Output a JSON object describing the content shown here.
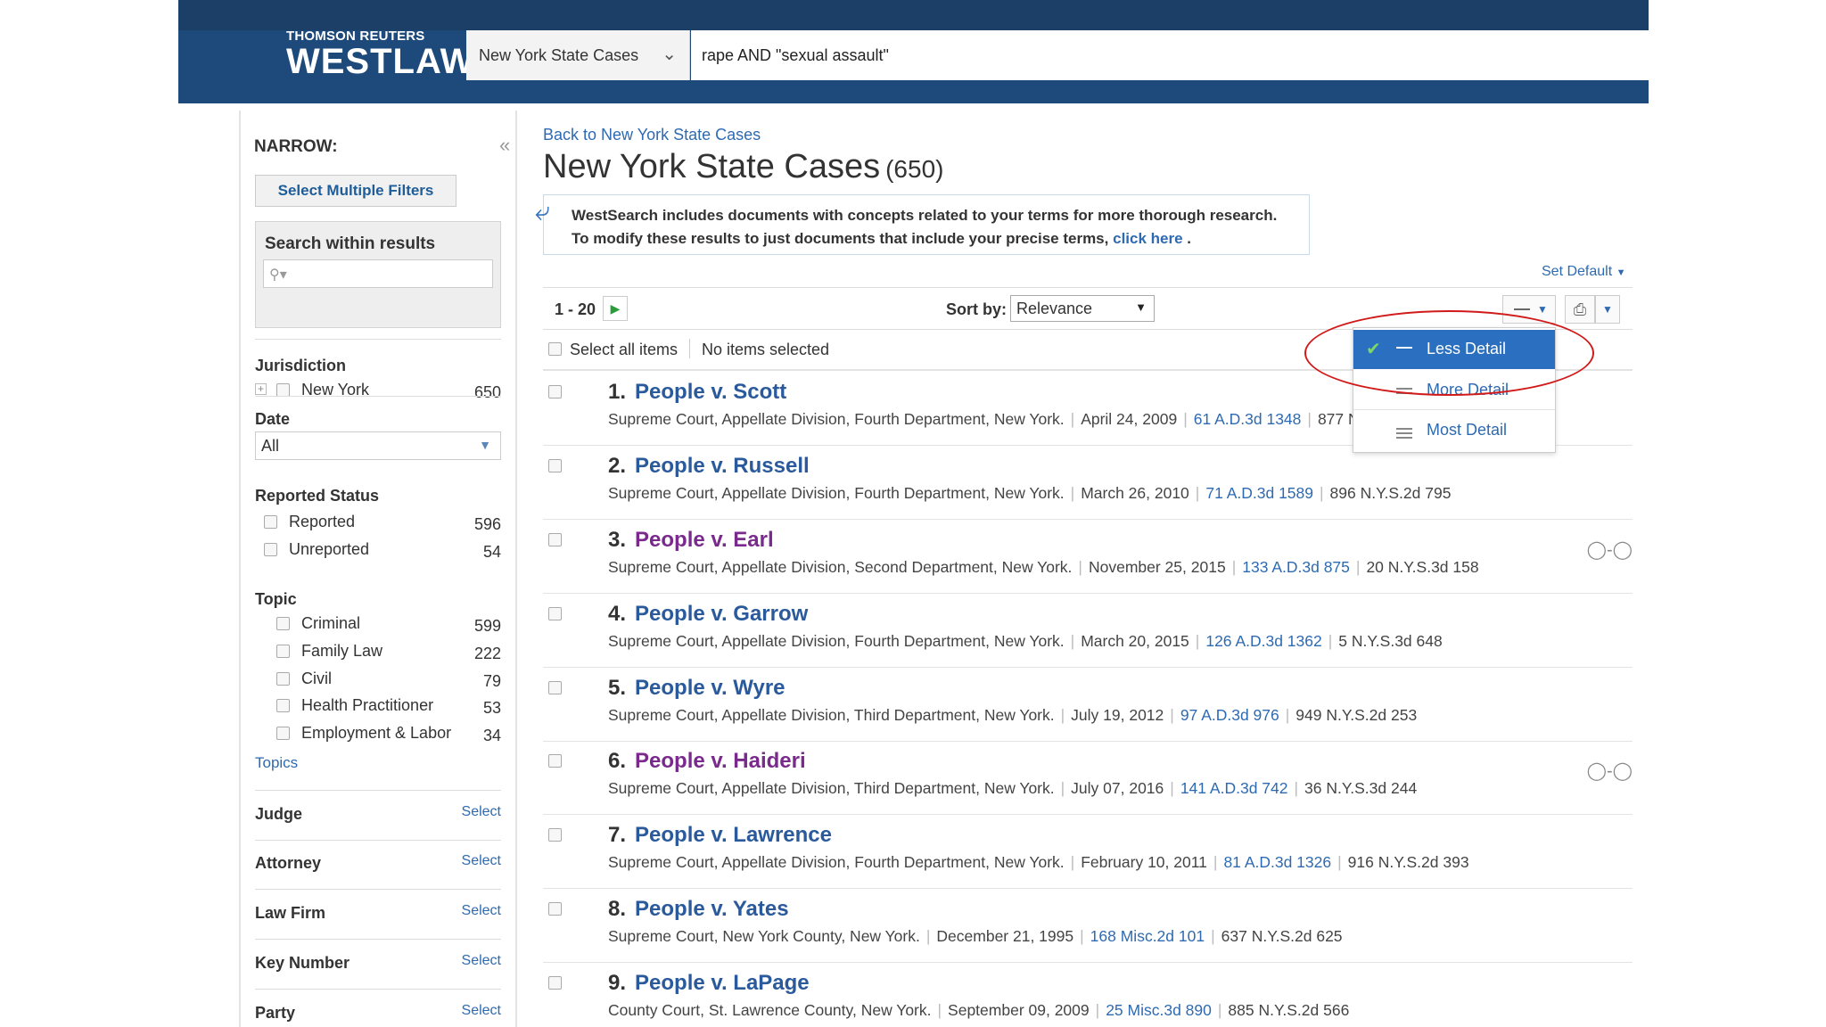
{
  "header": {
    "brand_top": "THOMSON REUTERS",
    "brand_main": "WESTLAW",
    "jurisdiction": "New York State Cases",
    "query": "rape AND \"sexual assault\""
  },
  "sidebar": {
    "narrow_label": "NARROW:",
    "multi_filter_button": "Select Multiple Filters",
    "search_within_label": "Search within results",
    "jurisdiction": {
      "title": "Jurisdiction",
      "items": [
        {
          "label": "New York",
          "count": "650"
        }
      ]
    },
    "date": {
      "title": "Date",
      "value": "All"
    },
    "reported_status": {
      "title": "Reported Status",
      "items": [
        {
          "label": "Reported",
          "count": "596"
        },
        {
          "label": "Unreported",
          "count": "54"
        }
      ]
    },
    "topic": {
      "title": "Topic",
      "items": [
        {
          "label": "Criminal",
          "count": "599"
        },
        {
          "label": "Family Law",
          "count": "222"
        },
        {
          "label": "Civil",
          "count": "79"
        },
        {
          "label": "Health Practitioner",
          "count": "53"
        },
        {
          "label": "Employment & Labor",
          "count": "34"
        }
      ],
      "more_link": "Topics"
    },
    "facets": [
      {
        "title": "Judge",
        "action": "Select"
      },
      {
        "title": "Attorney",
        "action": "Select"
      },
      {
        "title": "Law Firm",
        "action": "Select"
      },
      {
        "title": "Key Number",
        "action": "Select"
      },
      {
        "title": "Party",
        "action": "Select"
      }
    ]
  },
  "main": {
    "back_link": "Back to New York State Cases",
    "title": "New York State Cases",
    "count": "(650)",
    "notice_line1": "WestSearch includes documents with concepts related to your terms for more thorough research.",
    "notice_line2": "To modify these results to just documents that include your precise terms,",
    "notice_link": "click here",
    "notice_end": ".",
    "set_default": "Set Default",
    "range": "1 - 20",
    "sort_label": "Sort by:",
    "sort_value": "Relevance",
    "select_all": "Select all items",
    "no_items": "No items selected"
  },
  "detail_menu": {
    "items": [
      {
        "label": "Less Detail"
      },
      {
        "label": "More Detail"
      },
      {
        "label": "Most Detail"
      }
    ]
  },
  "results": [
    {
      "num": "1.",
      "title": "People v. Scott",
      "court": "Supreme Court, Appellate Division, Fourth Department, New York.",
      "date": "April 24, 2009",
      "cite1": "61 A.D.3d 1348",
      "cite2": "877 N.Y.S.2d 582"
    },
    {
      "num": "2.",
      "title": "People v. Russell",
      "court": "Supreme Court, Appellate Division, Fourth Department, New York.",
      "date": "March 26, 2010",
      "cite1": "71 A.D.3d 1589",
      "cite2": "896 N.Y.S.2d 795"
    },
    {
      "num": "3.",
      "title": "People v. Earl",
      "court": "Supreme Court, Appellate Division, Second Department, New York.",
      "date": "November 25, 2015",
      "cite1": "133 A.D.3d 875",
      "cite2": "20 N.Y.S.3d 158",
      "visited": true
    },
    {
      "num": "4.",
      "title": "People v. Garrow",
      "court": "Supreme Court, Appellate Division, Fourth Department, New York.",
      "date": "March 20, 2015",
      "cite1": "126 A.D.3d 1362",
      "cite2": "5 N.Y.S.3d 648"
    },
    {
      "num": "5.",
      "title": "People v. Wyre",
      "court": "Supreme Court, Appellate Division, Third Department, New York.",
      "date": "July 19, 2012",
      "cite1": "97 A.D.3d 976",
      "cite2": "949 N.Y.S.2d 253"
    },
    {
      "num": "6.",
      "title": "People v. Haideri",
      "court": "Supreme Court, Appellate Division, Third Department, New York.",
      "date": "July 07, 2016",
      "cite1": "141 A.D.3d 742",
      "cite2": "36 N.Y.S.3d 244",
      "visited": true
    },
    {
      "num": "7.",
      "title": "People v. Lawrence",
      "court": "Supreme Court, Appellate Division, Fourth Department, New York.",
      "date": "February 10, 2011",
      "cite1": "81 A.D.3d 1326",
      "cite2": "916 N.Y.S.2d 393"
    },
    {
      "num": "8.",
      "title": "People v. Yates",
      "court": "Supreme Court, New York County, New York.",
      "date": "December 21, 1995",
      "cite1": "168 Misc.2d 101",
      "cite2": "637 N.Y.S.2d 625"
    },
    {
      "num": "9.",
      "title": "People v. LaPage",
      "court": "County Court, St. Lawrence County, New York.",
      "date": "September 09, 2009",
      "cite1": "25 Misc.3d 890",
      "cite2": "885 N.Y.S.2d 566"
    }
  ]
}
